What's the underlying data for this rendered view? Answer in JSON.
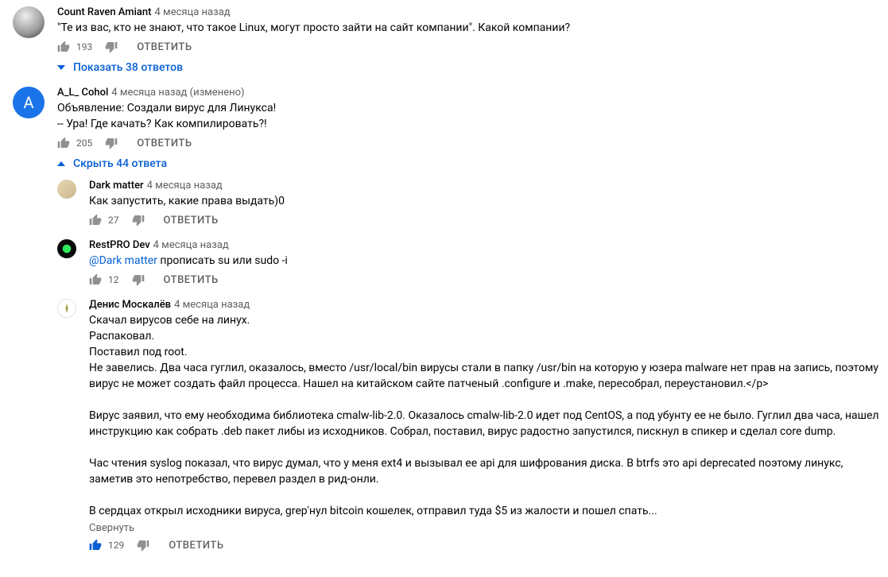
{
  "labels": {
    "reply": "ОТВЕТИТЬ",
    "read_less": "Свернуть"
  },
  "comments": [
    {
      "author": "Count Raven Amiant",
      "time": "4 месяца назад",
      "text": "\"Те из вас, кто не знают, что такое Linux, могут просто зайти на сайт компании\". Какой компании?",
      "likes": "193",
      "liked": false,
      "toggle": "Показать 38 ответов",
      "toggle_dir": "down"
    },
    {
      "author": "A_L_ Cohol",
      "time": "4 месяца назад (изменено)",
      "text": "Объявление: Создали вирус для Линукса!\n-- Ура! Где качать? Как компилировать?!",
      "likes": "205",
      "liked": false,
      "toggle": "Скрыть 44 ответа",
      "toggle_dir": "up",
      "replies": [
        {
          "author": "Dark matter",
          "time": "4 месяца назад",
          "text": "Как запустить, какие права выдать)0",
          "likes": "27",
          "liked": false
        },
        {
          "author": "RestPRO Dev",
          "time": "4 месяца назад",
          "mention": "@Dark matter",
          "text": " прописать su или sudo -i",
          "likes": "12",
          "liked": false
        },
        {
          "author": "Денис Москалёв",
          "time": "4 месяца назад",
          "text": "Скачал вирусов себе на линух.\nРаспаковал.\nПоставил под root.\nНе завелись. Два часа гуглил, оказалось, вместо /usr/local/bin вирусы стали в папку /usr/bin на которую у юзера malware нет прав на запись, поэтому вирус не может создать файл процесса. Нашел на китайском сайте патченый .configure и .make, пересобрал, переустановил.</p>\n\nВирус заявил, что ему необходима библиотека cmalw-lib-2.0. Оказалось cmalw-lib-2.0 идет под CentOS, а под убунту ее не было. Гуглил два часа, нашел инструкцию как собрать .deb пакет либы из исходников. Собрал, поставил, вирус радостно запустился, пискнул в спикер и сделал core dump.\n\nЧас чтения syslog показал, что вирус думал, что у меня ext4 и вызывал ее api для шифрования диска. В btrfs это api deprecated поэтому линукс, заметив это непотребство, перевел раздел в рид-онли.\n\nВ сердцах открыл исходники вируса, grep'нул bitcoin кошелек, отправил туда $5 из жалости и пошел спать...",
          "likes": "129",
          "liked": true,
          "read_less": true
        }
      ]
    }
  ]
}
